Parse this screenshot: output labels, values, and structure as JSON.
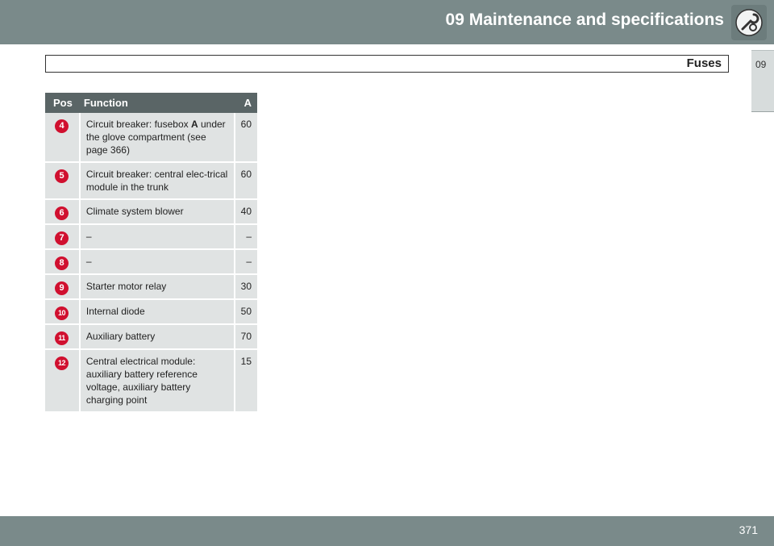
{
  "header": {
    "chapter_title": "09 Maintenance and specifications",
    "chapter_icon": "wrench-gear-icon",
    "section_title": "Fuses",
    "side_tab": "09"
  },
  "table": {
    "headers": {
      "pos": "Pos",
      "function": "Function",
      "amp": "A"
    },
    "rows": [
      {
        "pos": "4",
        "function": "Circuit breaker: fusebox",
        "function_bold": "A",
        "function_rest": "under the glove compartment (see page 366)",
        "amp": "60"
      },
      {
        "pos": "5",
        "function": "Circuit breaker: central elec-trical module in the trunk",
        "amp": "60"
      },
      {
        "pos": "6",
        "function": "Climate system blower",
        "amp": "40"
      },
      {
        "pos": "7",
        "function": "–",
        "amp": "–"
      },
      {
        "pos": "8",
        "function": "–",
        "amp": "–"
      },
      {
        "pos": "9",
        "function": "Starter motor relay",
        "amp": "30"
      },
      {
        "pos": "10",
        "function": "Internal diode",
        "amp": "50"
      },
      {
        "pos": "11",
        "function": "Auxiliary battery",
        "amp": "70"
      },
      {
        "pos": "12",
        "function": "Central electrical module: auxiliary battery reference voltage, auxiliary battery charging point",
        "amp": "15"
      }
    ]
  },
  "footer": {
    "page_number": "371"
  },
  "colors": {
    "bar": "#7a8a8a",
    "table_header": "#5a6566",
    "row_bg": "#e0e3e3",
    "badge": "#d0102f"
  }
}
